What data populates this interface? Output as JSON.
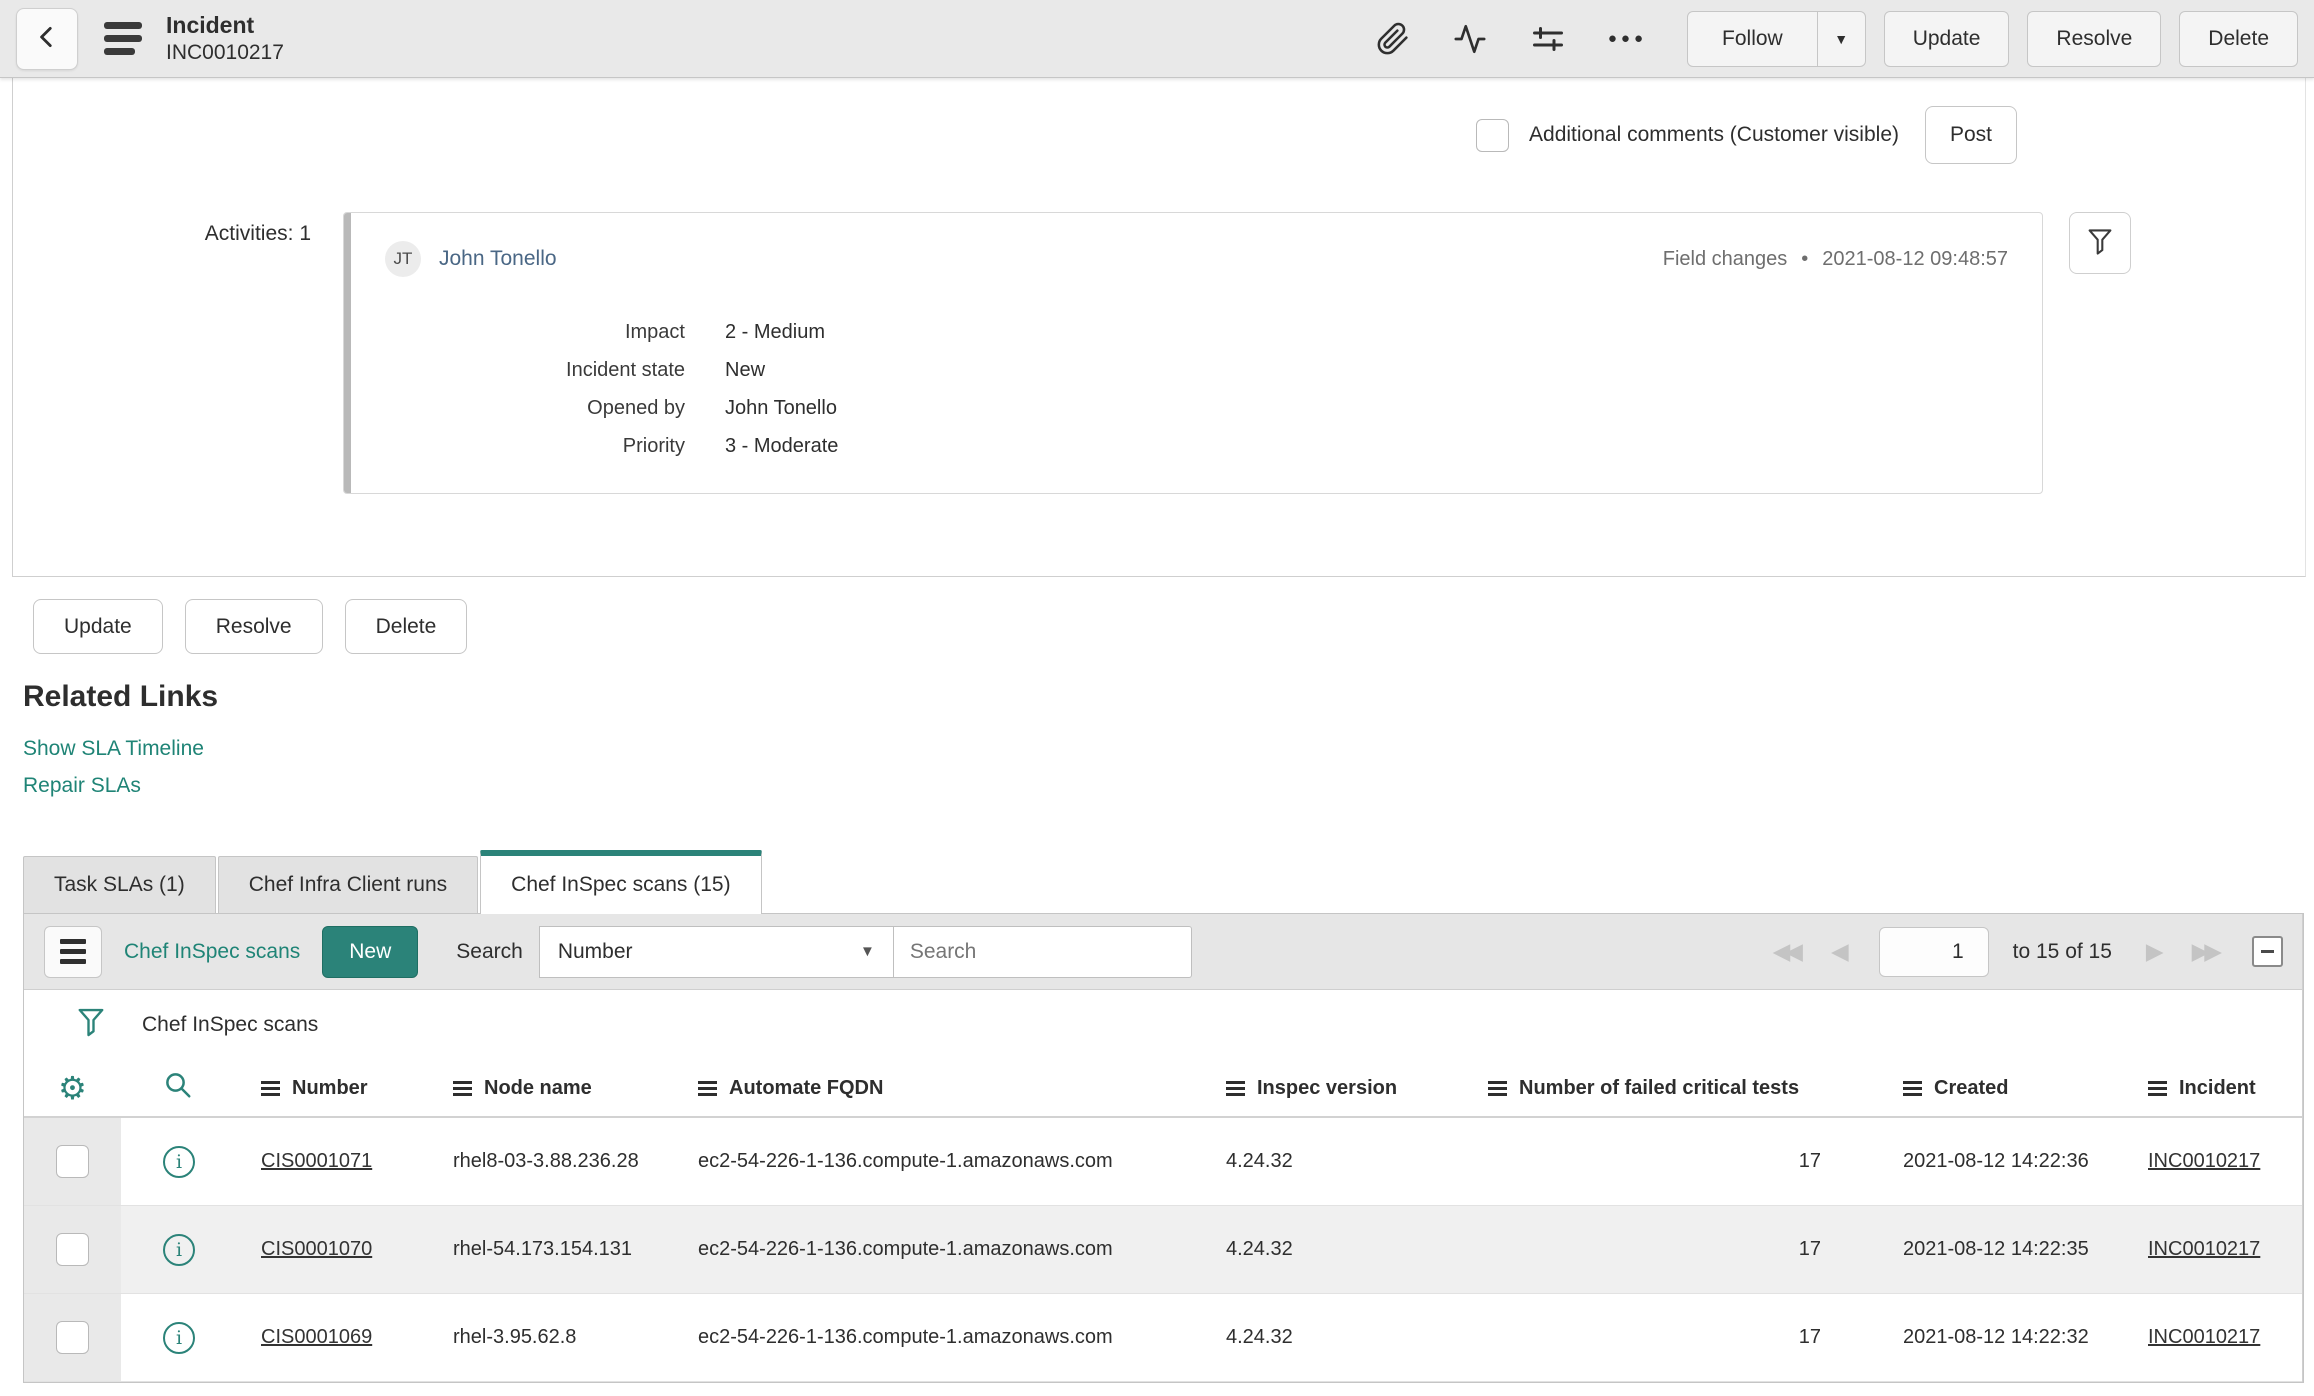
{
  "colors": {
    "accent_teal": "#2b8379",
    "link_teal": "#1f8476",
    "author_blue": "#4a6785"
  },
  "header": {
    "title": "Incident",
    "record_id": "INC0010217",
    "icons": [
      "back-chevron-icon",
      "menu-icon",
      "paperclip-icon",
      "activity-stream-icon",
      "personalize-icon",
      "more-options-icon"
    ],
    "follow_label": "Follow",
    "update_label": "Update",
    "resolve_label": "Resolve",
    "delete_label": "Delete"
  },
  "comments": {
    "label": "Additional comments (Customer visible)",
    "post_label": "Post"
  },
  "activities": {
    "label": "Activities: 1",
    "entry": {
      "avatar_initials": "JT",
      "author": "John Tonello",
      "event_type": "Field changes",
      "separator": "•",
      "timestamp": "2021-08-12 09:48:57",
      "fields": [
        {
          "label": "Impact",
          "value": "2 - Medium"
        },
        {
          "label": "Incident state",
          "value": "New"
        },
        {
          "label": "Opened by",
          "value": "John Tonello"
        },
        {
          "label": "Priority",
          "value": "3 - Moderate"
        }
      ]
    }
  },
  "form_actions": {
    "update": "Update",
    "resolve": "Resolve",
    "delete": "Delete"
  },
  "related_links": {
    "title": "Related Links",
    "links": [
      {
        "label": "Show SLA Timeline"
      },
      {
        "label": "Repair SLAs"
      }
    ]
  },
  "tabs": [
    {
      "label": "Task SLAs (1)",
      "active": false
    },
    {
      "label": "Chef Infra Client runs",
      "active": false
    },
    {
      "label": "Chef InSpec scans (15)",
      "active": true
    }
  ],
  "list": {
    "title": "Chef InSpec scans",
    "new_label": "New",
    "search_label": "Search",
    "search_column": "Number",
    "search_placeholder": "Search",
    "pagination": {
      "page": "1",
      "range": "to 15 of 15"
    },
    "filter_caption": "Chef InSpec scans",
    "columns": [
      "Number",
      "Node name",
      "Automate FQDN",
      "Inspec version",
      "Number of failed critical tests",
      "Created",
      "Incident"
    ],
    "rows": [
      {
        "number": "CIS0001071",
        "node_name": "rhel8-03-3.88.236.28",
        "automate_fqdn": "ec2-54-226-1-136.compute-1.amazonaws.com",
        "inspec_version": "4.24.32",
        "failed_critical_tests": "17",
        "created": "2021-08-12 14:22:36",
        "incident": "INC0010217"
      },
      {
        "number": "CIS0001070",
        "node_name": "rhel-54.173.154.131",
        "automate_fqdn": "ec2-54-226-1-136.compute-1.amazonaws.com",
        "inspec_version": "4.24.32",
        "failed_critical_tests": "17",
        "created": "2021-08-12 14:22:35",
        "incident": "INC0010217"
      },
      {
        "number": "CIS0001069",
        "node_name": "rhel-3.95.62.8",
        "automate_fqdn": "ec2-54-226-1-136.compute-1.amazonaws.com",
        "inspec_version": "4.24.32",
        "failed_critical_tests": "17",
        "created": "2021-08-12 14:22:32",
        "incident": "INC0010217"
      }
    ]
  }
}
